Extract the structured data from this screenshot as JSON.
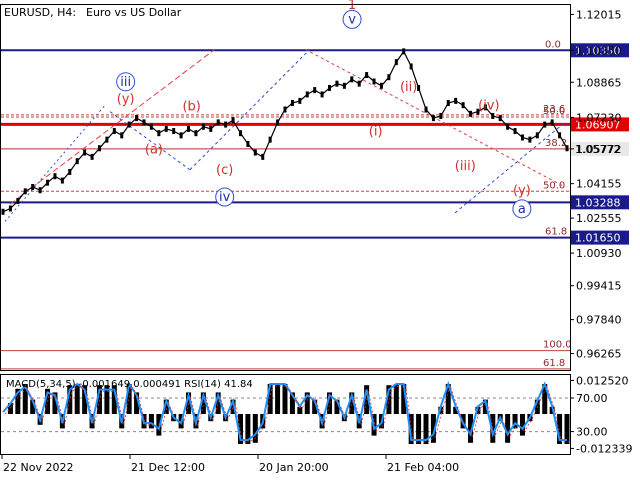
{
  "header": {
    "symbol": "EURUSD, H4:",
    "description": "Euro vs US Dollar"
  },
  "chart_data": {
    "type": "line",
    "series": [
      {
        "values": [
          1.0285,
          1.03,
          1.0335,
          1.038,
          1.04,
          1.0385,
          1.042,
          1.045,
          1.043,
          1.047,
          1.052,
          1.056,
          1.054,
          1.058,
          1.062,
          1.066,
          1.064,
          1.069,
          1.072,
          1.07,
          1.068,
          1.065,
          1.067,
          1.066,
          1.064,
          1.067,
          1.065,
          1.068,
          1.067,
          1.07,
          1.069,
          1.071,
          1.065,
          1.06,
          1.056,
          1.054,
          1.062,
          1.07,
          1.076,
          1.079,
          1.08,
          1.083,
          1.085,
          1.083,
          1.086,
          1.088,
          1.087,
          1.09,
          1.088,
          1.092,
          1.089,
          1.087,
          1.091,
          1.098,
          1.103,
          1.096,
          1.086,
          1.076,
          1.072,
          1.073,
          1.079,
          1.08,
          1.078,
          1.074,
          1.075,
          1.077,
          1.073,
          1.072,
          1.068,
          1.066,
          1.063,
          1.062,
          1.064,
          1.069,
          1.07,
          1.064,
          1.058
        ]
      }
    ],
    "y_ticks": [
      "1.12015",
      "1.10350",
      "1.08865",
      "1.07230",
      "1.05772",
      "1.04155",
      "1.02555",
      "1.00930",
      "0.99415",
      "0.97840",
      "0.96265"
    ],
    "x_ticks": [
      "22 Nov 2022",
      "21 Dec 12:00",
      "20 Jan 20:00",
      "21 Feb 04:00"
    ],
    "ylim": [
      0.955,
      1.125
    ],
    "levels": [
      {
        "value": 1.1035,
        "tag": "1.10350",
        "fib": "0.0"
      },
      {
        "value": 1.06907,
        "tag": "1.06907"
      },
      {
        "value": 1.05772,
        "tag": "1.05772",
        "fib": "38.2"
      },
      {
        "value": 1.03288,
        "tag": "1.03288"
      },
      {
        "value": 1.0165,
        "tag": "1.01650",
        "fib": "61.8"
      },
      {
        "fib": "23.6",
        "value": 1.0735
      },
      {
        "fib": "50.0",
        "value": 1.038
      },
      {
        "fib": "50.0",
        "value": 1.0725
      },
      {
        "fib": "100.0",
        "value": 0.964
      },
      {
        "fib": "61.8",
        "value": 0.9555
      }
    ],
    "wave_labels": [
      {
        "text": "1",
        "x": 74,
        "y": 1.1226
      },
      {
        "text": "v",
        "x": 74,
        "y": 1.116
      },
      {
        "text": "iii",
        "x": 26,
        "y": 1.087
      },
      {
        "text": "(y)",
        "x": 26,
        "y": 1.079
      },
      {
        "text": "(b)",
        "x": 40,
        "y": 1.0755
      },
      {
        "text": "(a)",
        "x": 32,
        "y": 1.0555
      },
      {
        "text": "(c)",
        "x": 47,
        "y": 1.046
      },
      {
        "text": "iv",
        "x": 47,
        "y": 1.0335
      },
      {
        "text": "(ii)",
        "x": 86,
        "y": 1.0845
      },
      {
        "text": "(i)",
        "x": 79,
        "y": 1.064
      },
      {
        "text": "(iv)",
        "x": 103,
        "y": 1.076
      },
      {
        "text": "(iii)",
        "x": 98,
        "y": 1.048
      },
      {
        "text": "(y)",
        "x": 110,
        "y": 1.0365
      },
      {
        "text": "a",
        "x": 110,
        "y": 1.028
      }
    ],
    "indicator": {
      "label": "MACD(5,34,5) -0.001649 0.000491 RSI(14) 41.84",
      "y_ticks": [
        "0.012520",
        "70.00",
        "30.00",
        "-0.012339"
      ]
    }
  }
}
